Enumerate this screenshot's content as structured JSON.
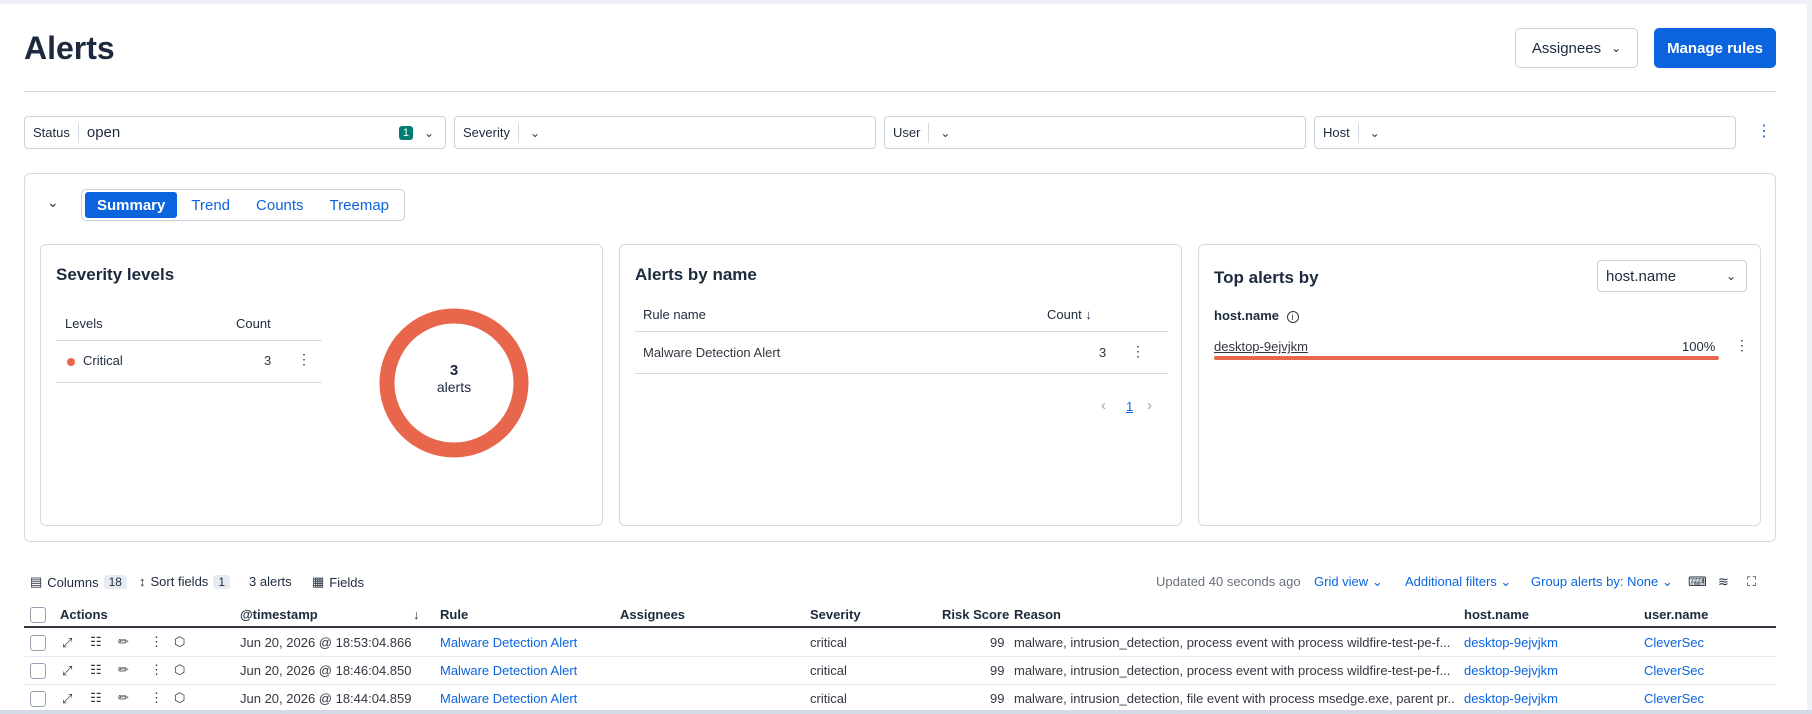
{
  "header": {
    "title": "Alerts",
    "assignees_label": "Assignees",
    "manage_rules_label": "Manage rules"
  },
  "filters": [
    {
      "label": "Status",
      "value": "open",
      "count": "1"
    },
    {
      "label": "Severity",
      "value": ""
    },
    {
      "label": "User",
      "value": ""
    },
    {
      "label": "Host",
      "value": ""
    }
  ],
  "tabs": [
    "Summary",
    "Trend",
    "Counts",
    "Treemap"
  ],
  "severity_card": {
    "title": "Severity levels",
    "col_levels": "Levels",
    "col_count": "Count",
    "rows": [
      {
        "level": "Critical",
        "count": "3"
      }
    ],
    "donut_count": "3",
    "donut_label": "alerts",
    "donut_color": "#e7664c"
  },
  "alerts_by_name_card": {
    "title": "Alerts by name",
    "col_rule": "Rule name",
    "col_count": "Count",
    "rows": [
      {
        "rule": "Malware Detection Alert",
        "count": "3"
      }
    ],
    "page": "1"
  },
  "top_alerts_card": {
    "title": "Top alerts by",
    "select_value": "host.name",
    "field_label": "host.name",
    "rows": [
      {
        "name": "desktop-9ejvjkm",
        "percent": "100%",
        "fraction": 1.0
      }
    ],
    "bar_color": "#e7664c"
  },
  "toolbar": {
    "columns_label": "Columns",
    "columns_count": "18",
    "sort_label": "Sort fields",
    "sort_count": "1",
    "alerts_count": "3 alerts",
    "fields_label": "Fields",
    "updated": "Updated 40 seconds ago",
    "grid_view": "Grid view",
    "additional_filters": "Additional filters",
    "group_alerts": "Group alerts by: None"
  },
  "grid": {
    "headers": {
      "actions": "Actions",
      "timestamp": "@timestamp",
      "rule": "Rule",
      "assignees": "Assignees",
      "severity": "Severity",
      "risk": "Risk Score",
      "reason": "Reason",
      "host": "host.name",
      "user": "user.name"
    },
    "rows": [
      {
        "timestamp": "Jun 20, 2026 @ 18:53:04.866",
        "rule": "Malware Detection Alert",
        "severity": "critical",
        "risk": "99",
        "reason": "malware, intrusion_detection, process event with process wildfire-test-pe-f...",
        "host": "desktop-9ejvjkm",
        "user": "CleverSec"
      },
      {
        "timestamp": "Jun 20, 2026 @ 18:46:04.850",
        "rule": "Malware Detection Alert",
        "severity": "critical",
        "risk": "99",
        "reason": "malware, intrusion_detection, process event with process wildfire-test-pe-f...",
        "host": "desktop-9ejvjkm",
        "user": "CleverSec"
      },
      {
        "timestamp": "Jun 20, 2026 @ 18:44:04.859",
        "rule": "Malware Detection Alert",
        "severity": "critical",
        "risk": "99",
        "reason": "malware, intrusion_detection, file event with process msedge.exe, parent pr...",
        "host": "desktop-9ejvjkm",
        "user": "CleverSec"
      }
    ]
  }
}
